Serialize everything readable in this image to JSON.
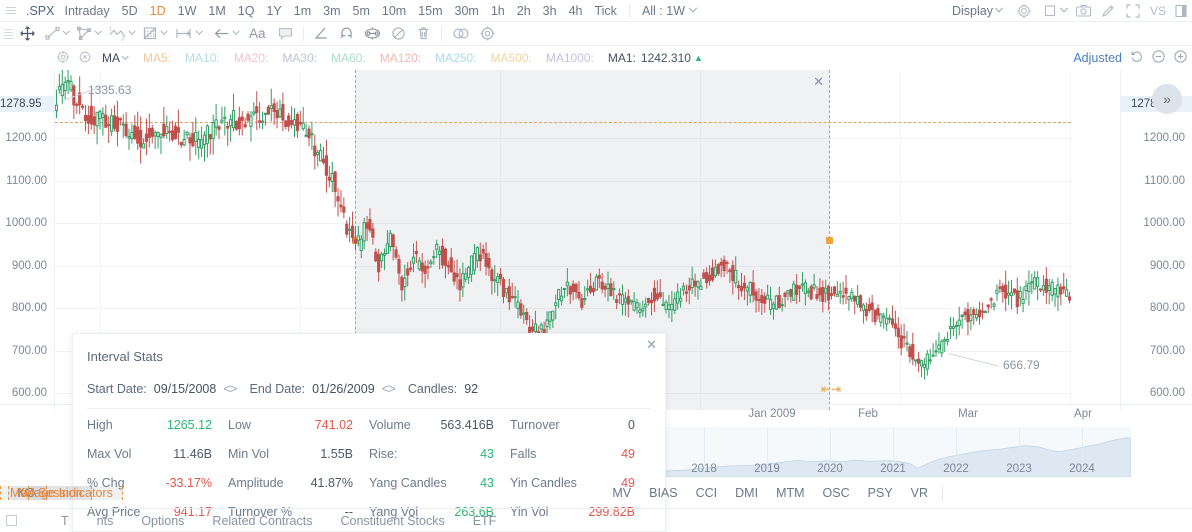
{
  "topbar": {
    "symbol": ".SPX",
    "periods": [
      {
        "label": "Intraday",
        "active": false
      },
      {
        "label": "5D",
        "active": false
      },
      {
        "label": "1D",
        "active": true
      },
      {
        "label": "1W",
        "active": false
      },
      {
        "label": "1M",
        "active": false
      },
      {
        "label": "1Q",
        "active": false
      },
      {
        "label": "1Y",
        "active": false
      },
      {
        "label": "1m",
        "active": false
      },
      {
        "label": "3m",
        "active": false
      },
      {
        "label": "5m",
        "active": false
      },
      {
        "label": "10m",
        "active": false
      },
      {
        "label": "15m",
        "active": false
      },
      {
        "label": "30m",
        "active": false
      },
      {
        "label": "1h",
        "active": false
      },
      {
        "label": "2h",
        "active": false
      },
      {
        "label": "3h",
        "active": false
      },
      {
        "label": "4h",
        "active": false
      },
      {
        "label": "Tick",
        "active": false
      }
    ],
    "all_selector": "All : 1W",
    "display_label": "Display",
    "icons": [
      "gear-icon",
      "layout-icon",
      "camera-icon",
      "pencil-icon",
      "fullscreen-icon",
      "vs-icon",
      "panel-icon"
    ]
  },
  "drawbar": {
    "tools": [
      {
        "name": "cursor-move-icon",
        "caret": false
      },
      {
        "name": "trend-line-icon",
        "caret": true
      },
      {
        "name": "polygon-icon",
        "caret": true
      },
      {
        "name": "wave-icon",
        "caret": true
      },
      {
        "name": "fib-box-icon",
        "caret": true
      },
      {
        "name": "measure-icon",
        "caret": true
      },
      {
        "name": "arrow-left-icon",
        "caret": true
      },
      {
        "name": "text-icon",
        "caret": false
      },
      {
        "name": "comment-icon",
        "caret": false
      }
    ],
    "tools2": [
      {
        "name": "angle-icon",
        "caret": false
      },
      {
        "name": "magnet-icon",
        "caret": false
      },
      {
        "name": "lock-shape-icon",
        "caret": false
      },
      {
        "name": "hide-icon",
        "caret": false
      },
      {
        "name": "trash-icon",
        "caret": false
      }
    ],
    "tools3": [
      {
        "name": "link-icon",
        "caret": false
      },
      {
        "name": "settings-icon",
        "caret": false
      }
    ]
  },
  "mabar": {
    "ma_name": "MA",
    "items": [
      {
        "label": "MA5:",
        "color": "#f3c89f"
      },
      {
        "label": "MA10:",
        "color": "#b6dbe8"
      },
      {
        "label": "MA20:",
        "color": "#f0c3d4"
      },
      {
        "label": "MA30:",
        "color": "#b8c8d8"
      },
      {
        "label": "MA60:",
        "color": "#a8ddcb"
      },
      {
        "label": "MA120:",
        "color": "#f2b8b0"
      },
      {
        "label": "MA250:",
        "color": "#a9dbe8"
      },
      {
        "label": "MA500:",
        "color": "#f0d3a0"
      },
      {
        "label": "MA1000:",
        "color": "#c8bede"
      }
    ],
    "ma1_label": "MA1:",
    "ma1_value": "1242.310",
    "ma1_arrow": "▲",
    "adjusted": "Adjusted"
  },
  "chart_data": {
    "type": "candlestick",
    "title": ".SPX",
    "ylabel": "",
    "xlabel": "",
    "ylim": [
      560,
      1360
    ],
    "y_ticks_left": [
      "1278.95",
      "1200.00",
      "1100.00",
      "1000.00",
      "900.00",
      "800.00",
      "700.00",
      "600.00"
    ],
    "y_ticks_right": [
      "1278.95",
      "1200.00",
      "1100.00",
      "1000.00",
      "900.00",
      "800.00",
      "700.00",
      "600.00"
    ],
    "highlighted_price": "1278.95",
    "x_ticks": [
      "Jan 2009",
      "Feb",
      "Mar",
      "Apr"
    ],
    "annotations": [
      {
        "text": "1335.63",
        "role": "period-high"
      },
      {
        "text": "666.79",
        "role": "period-low"
      }
    ],
    "reference_line": {
      "value": "1278.95",
      "style": "dashed",
      "color": "#e0a35e"
    },
    "selection": {
      "start": "09/15/2008",
      "end": "01/26/2009",
      "candles": "92"
    },
    "navigator": {
      "years": [
        "2018",
        "2019",
        "2020",
        "2021",
        "2022",
        "2023",
        "2024"
      ],
      "type": "area"
    },
    "candles_up_color": "#2f9e63",
    "candles_down_color": "#c0504d"
  },
  "stats": {
    "title": "Interval Stats",
    "start_label": "Start Date:",
    "start_value": "09/15/2008",
    "end_label": "End Date:",
    "end_value": "01/26/2009",
    "candles_label": "Candles:",
    "candles_value": "92",
    "arrows": "<>",
    "rows": [
      [
        {
          "k": "High",
          "v": "1265.12",
          "tone": "up"
        },
        {
          "k": "Low",
          "v": "741.02",
          "tone": "dn"
        },
        {
          "k": "Volume",
          "v": "563.416B",
          "tone": ""
        },
        {
          "k": "Turnover",
          "v": "0",
          "tone": ""
        }
      ],
      [
        {
          "k": "Max Vol",
          "v": "11.46B",
          "tone": ""
        },
        {
          "k": "Min Vol",
          "v": "1.55B",
          "tone": ""
        },
        {
          "k": "Rise:",
          "v": "43",
          "tone": "up"
        },
        {
          "k": "Falls",
          "v": "49",
          "tone": "dn"
        }
      ],
      [
        {
          "k": "% Chg",
          "v": "-33.17%",
          "tone": "dn"
        },
        {
          "k": "Amplitude",
          "v": "41.87%",
          "tone": ""
        },
        {
          "k": "Yang Candles",
          "v": "43",
          "tone": "up"
        },
        {
          "k": "Yin Candles",
          "v": "49",
          "tone": "dn"
        }
      ],
      [
        {
          "k": "Avg Price",
          "v": "941.17",
          "tone": "dn"
        },
        {
          "k": "Turnover %",
          "v": "--",
          "tone": ""
        },
        {
          "k": "Yang Vol",
          "v": "263.6B",
          "tone": "up"
        },
        {
          "k": "Yin Vol",
          "v": "299.82B",
          "tone": "dn"
        }
      ]
    ]
  },
  "botbar": {
    "left_items": [
      {
        "label": "MA",
        "selected": true
      },
      {
        "label": "KC",
        "selected": false
      }
    ],
    "right_items": [
      {
        "label": "MV",
        "selected": false
      },
      {
        "label": "BIAS",
        "selected": false
      },
      {
        "label": "CCI",
        "selected": false
      },
      {
        "label": "DMI",
        "selected": false
      },
      {
        "label": "MTM",
        "selected": false
      },
      {
        "label": "OSC",
        "selected": false
      },
      {
        "label": "PSY",
        "selected": false
      },
      {
        "label": "VR",
        "selected": false
      }
    ],
    "manage": "Manage Indicators",
    "session": "Session"
  },
  "tabbar": {
    "items": [
      "T",
      "nts",
      "Options",
      "Related Contracts",
      "Constituent Stocks",
      "ETF"
    ]
  }
}
